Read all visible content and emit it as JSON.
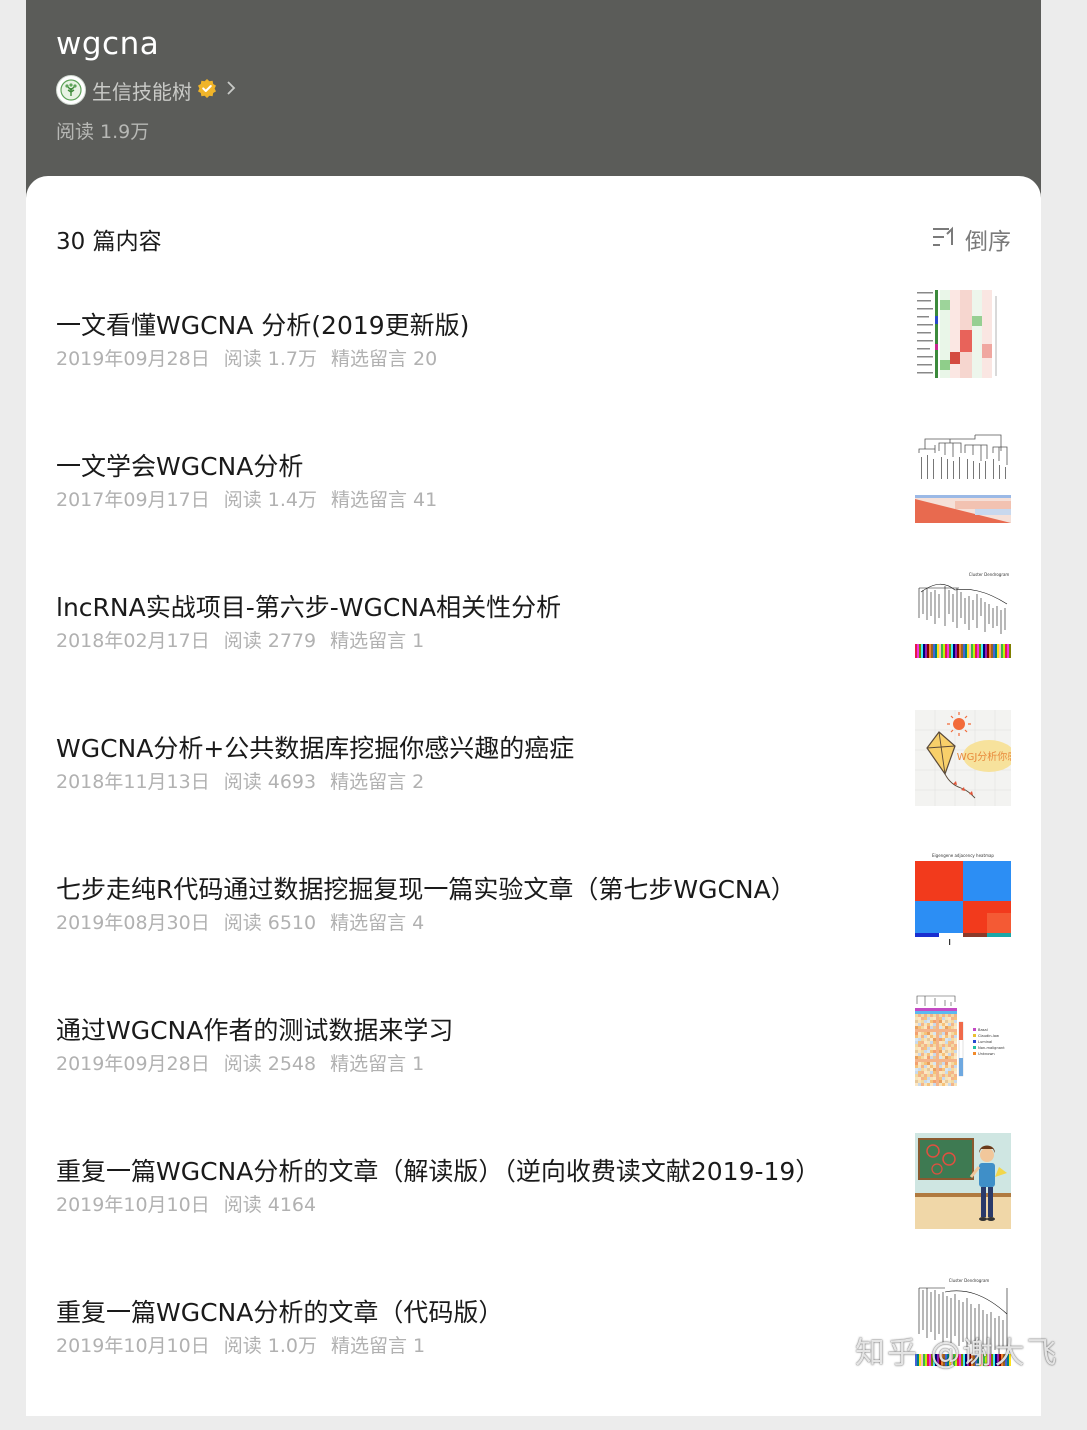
{
  "album": {
    "title": "wgcna",
    "author": "生信技能树",
    "reads": "阅读 1.9万"
  },
  "list": {
    "count": "30 篇内容",
    "sort_label": "倒序"
  },
  "articles": [
    {
      "title": "一文看懂WGCNA 分析(2019更新版)",
      "date": "2019年09月28日",
      "reads": "阅读 1.7万",
      "comments": "精选留言 20",
      "thumb": "heatmap-table"
    },
    {
      "title": "一文学会WGCNA分析",
      "date": "2017年09月17日",
      "reads": "阅读 1.4万",
      "comments": "精选留言 41",
      "thumb": "dendrogram-heatmap"
    },
    {
      "title": "lncRNA实战项目-第六步-WGCNA相关性分析",
      "date": "2018年02月17日",
      "reads": "阅读 2779",
      "comments": "精选留言 1",
      "thumb": "cluster-dendrogram"
    },
    {
      "title": "WGCNA分析+公共数据库挖掘你感兴趣的癌症",
      "date": "2018年11月13日",
      "reads": "阅读 4693",
      "comments": "精选留言 2",
      "thumb": "kite-illustration"
    },
    {
      "title": "七步走纯R代码通过数据挖掘复现一篇实验文章（第七步WGCNA）",
      "date": "2019年08月30日",
      "reads": "阅读 6510",
      "comments": "精选留言 4",
      "thumb": "eigengene-heatmap"
    },
    {
      "title": "通过WGCNA作者的测试数据来学习",
      "date": "2019年09月28日",
      "reads": "阅读 2548",
      "comments": "精选留言 1",
      "thumb": "clustered-heatmap"
    },
    {
      "title": "重复一篇WGCNA分析的文章（解读版）（逆向收费读文献2019-19）",
      "date": "2019年10月10日",
      "reads": "阅读 4164",
      "comments": "",
      "thumb": "teacher-cartoon"
    },
    {
      "title": "重复一篇WGCNA分析的文章（代码版）",
      "date": "2019年10月10日",
      "reads": "阅读 1.0万",
      "comments": "精选留言 1",
      "thumb": "cluster-dendrogram-2"
    }
  ],
  "thumb_text": {
    "t3": "Cluster Dendrogram",
    "t4": "WGJ分析你感",
    "t5": "Eigengene adjacency heatmap",
    "t6": [
      "Basal",
      "Claudin-low",
      "Luminal",
      "Non-malignant",
      "Unknown"
    ],
    "t8": "Cluster Dendrogram"
  },
  "watermark": "知乎 @谢大飞",
  "colors": {
    "header_bg": "#5b5c59",
    "verified": "#f0b429",
    "heat_red": "#f23a1c",
    "heat_blue": "#2c8ef4"
  }
}
